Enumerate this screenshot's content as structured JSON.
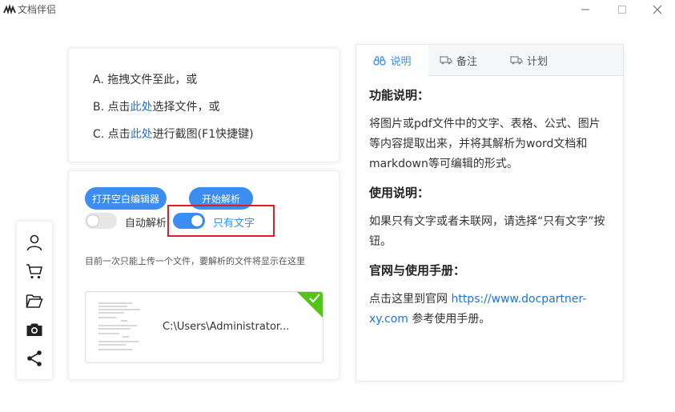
{
  "window": {
    "title": "文档伴侣",
    "logo_icon": "wavy-glyph-logo"
  },
  "drop_card": {
    "line_a": "A. 拖拽文件至此，或",
    "line_b_prefix": "B. 点击",
    "line_b_link": "此处",
    "line_b_suffix": "选择文件，或",
    "line_c_prefix": "C. 点击",
    "line_c_link": "此处",
    "line_c_suffix": "进行截图(F1快捷键)"
  },
  "controls": {
    "open_editor_label": "打开空白编辑器",
    "start_parse_label": "开始解析",
    "auto_parse_label": "自动解析",
    "auto_parse_on": false,
    "text_only_label": "只有文字",
    "text_only_on": true,
    "hint": "目前一次只能上传一个文件，要解析的文件将显示在这里",
    "file_name": "C:\\Users\\Administrator..."
  },
  "sidebar": {
    "icons": [
      "user-icon",
      "cart-icon",
      "folder-icon",
      "camera-icon",
      "share-icon"
    ]
  },
  "panel": {
    "tabs": [
      {
        "label": "说明",
        "icon": "binoculars-icon",
        "active": true
      },
      {
        "label": "备注",
        "icon": "truck-icon",
        "active": false
      },
      {
        "label": "计划",
        "icon": "truck-icon",
        "active": false
      }
    ],
    "func_title": "功能说明：",
    "func_text": "将图片或pdf文件中的文字、表格、公式、图片等内容提取出来，并将其解析为word文档和markdown等可编辑的形式。",
    "usage_title": "使用说明：",
    "usage_text": "如果只有文字或者未联网，请选择“只有文字”按钮。",
    "site_title": "官网与使用手册：",
    "site_prefix": "点击这里到官网 ",
    "site_link": "https://www.docpartner-xy.com",
    "site_suffix": " 参考使用手册。"
  },
  "colors": {
    "accent": "#3b8ef0",
    "highlight_box": "#e31b23",
    "check_badge": "#52c41a"
  }
}
